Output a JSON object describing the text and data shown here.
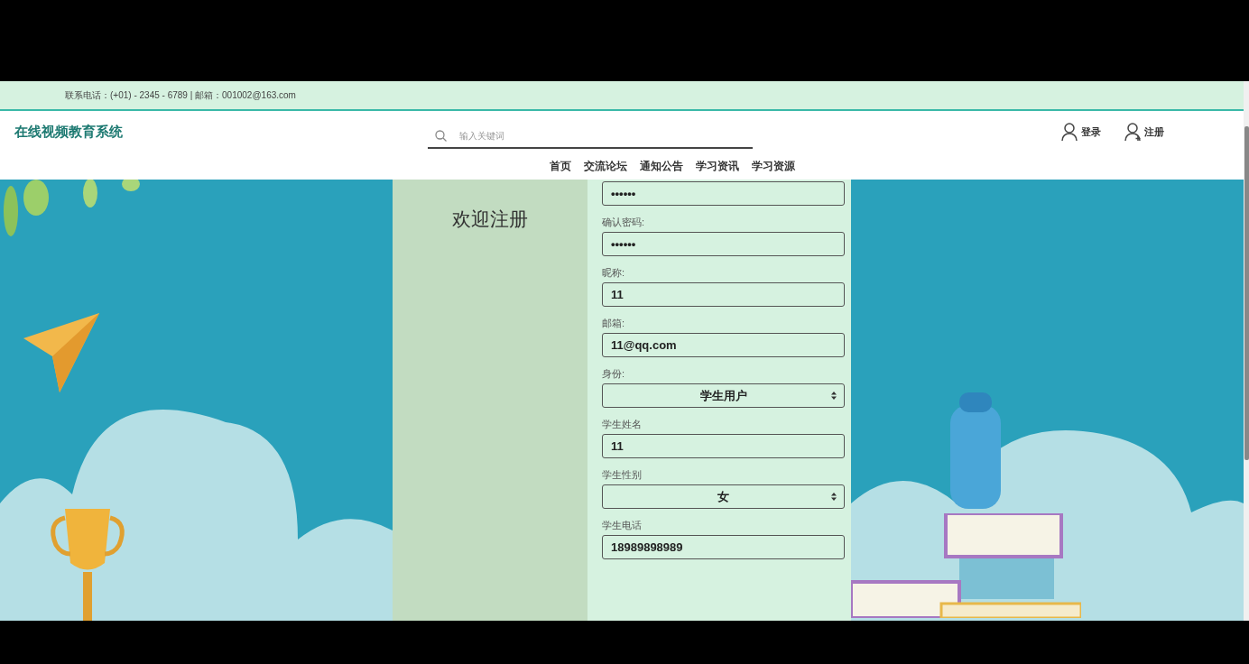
{
  "topbar": {
    "contact": "联系电话：(+01) - 2345 - 6789 | 邮箱：001002@163.com"
  },
  "header": {
    "logo": "在线视频教育系统",
    "search": {
      "placeholder": "输入关键词"
    },
    "actions": [
      {
        "kind": "login",
        "label": "登录"
      },
      {
        "kind": "register",
        "label": "注册"
      }
    ]
  },
  "nav": [
    "首页",
    "交流论坛",
    "通知公告",
    "学习资讯",
    "学习资源"
  ],
  "register": {
    "title": "欢迎注册",
    "fields": [
      {
        "kind": "password",
        "value": "••••••"
      },
      {
        "kind": "password",
        "label": "确认密码:",
        "value": "••••••"
      },
      {
        "kind": "text",
        "label": "昵称:",
        "value": "11"
      },
      {
        "kind": "text",
        "label": "邮箱:",
        "value": "11@qq.com"
      },
      {
        "kind": "select",
        "label": "身份:",
        "value": "学生用户"
      },
      {
        "kind": "text",
        "label": "学生姓名",
        "value": "11"
      },
      {
        "kind": "select",
        "label": "学生性别",
        "value": "女"
      },
      {
        "kind": "text",
        "label": "学生电话",
        "value": "18989898989"
      }
    ]
  }
}
